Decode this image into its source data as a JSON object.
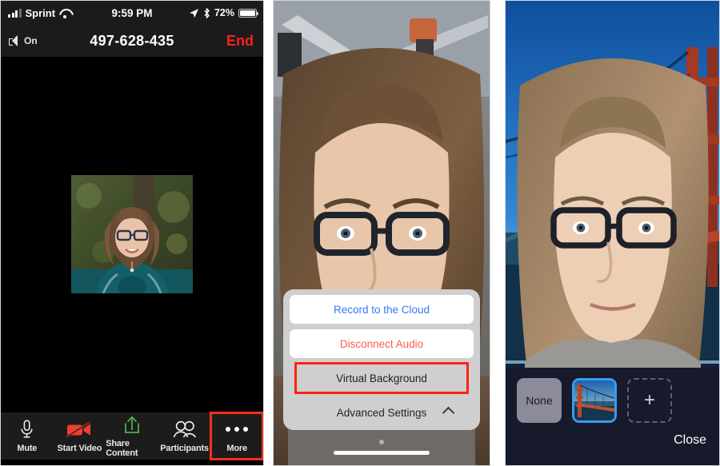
{
  "panels": {
    "phone1": {
      "status": {
        "carrier": "Sprint",
        "time": "9:59 PM",
        "battery_percent": "72%",
        "signal_icon": "signal-bars-icon",
        "wifi_icon": "wifi-icon",
        "location_icon": "location-arrow-icon",
        "bluetooth_icon": "bluetooth-icon",
        "battery_icon": "battery-icon"
      },
      "call": {
        "speaker_label": "On",
        "speaker_icon": "speaker-icon",
        "meeting_id": "497-628-435",
        "end_label": "End"
      },
      "toolbar": [
        {
          "label": "Mute",
          "icon": "microphone-icon",
          "highlighted": false
        },
        {
          "label": "Start Video",
          "icon": "video-off-icon",
          "highlighted": false
        },
        {
          "label": "Share Content",
          "icon": "share-upload-icon",
          "highlighted": false
        },
        {
          "label": "Participants",
          "icon": "participants-icon",
          "highlighted": false
        },
        {
          "label": "More",
          "icon": "more-dots-icon",
          "highlighted": true
        }
      ]
    },
    "phone2": {
      "sheet": [
        {
          "label": "Record to the Cloud",
          "style": "blue"
        },
        {
          "label": "Disconnect Audio",
          "style": "red"
        },
        {
          "label": "Virtual Background",
          "style": "dark",
          "highlighted": true
        },
        {
          "label": "Advanced Settings",
          "style": "dark",
          "chevron": "chevron-up-icon"
        }
      ]
    },
    "phone3": {
      "backgrounds": [
        {
          "label": "None",
          "type": "none",
          "selected": false
        },
        {
          "label": "",
          "type": "image-golden-gate-bridge",
          "selected": true
        },
        {
          "label": "+",
          "type": "add",
          "selected": false
        }
      ],
      "close_label": "Close"
    }
  },
  "colors": {
    "accent_red": "#fb2414",
    "link_blue": "#3478f6",
    "danger_red": "#fc5b4e",
    "selection_blue": "#3a9bf0",
    "panel_dark": "#161a2b"
  }
}
